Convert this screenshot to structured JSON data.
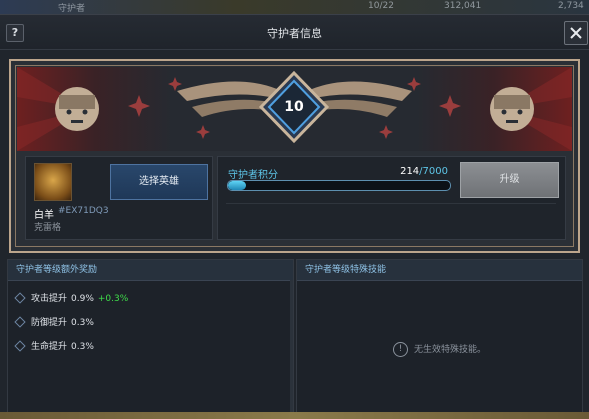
{
  "topbar": {
    "blur_left": "守护者",
    "blur_mid": "10/22",
    "blur_gold": "312,041",
    "blur_right": "2,734"
  },
  "header": {
    "help_label": "?",
    "title": "守护者信息"
  },
  "banner": {
    "level": "10"
  },
  "player": {
    "name": "白羊",
    "id": "#EX71DQ3",
    "subtitle": "克雷格",
    "select_button": "选择英雄"
  },
  "score": {
    "label": "守护者积分",
    "current": "214",
    "separator": "/",
    "max": "7000",
    "progress": 0.0306
  },
  "upgrade": {
    "label": "升级"
  },
  "bonus": {
    "title": "守护者等级额外奖励",
    "items": [
      {
        "label": "攻击提升",
        "value": "0.9%",
        "extra": "+0.3%"
      },
      {
        "label": "防御提升",
        "value": "0.3%",
        "extra": ""
      },
      {
        "label": "生命提升",
        "value": "0.3%",
        "extra": ""
      }
    ]
  },
  "skills": {
    "title": "守护者等级特殊技能",
    "empty_text": "无生效特殊技能。"
  },
  "colors": {
    "accent": "#5ec6e8",
    "bonus_green": "#3fdc4a",
    "frame_gold": "#bca58c",
    "banner_red": "#6e2020"
  }
}
